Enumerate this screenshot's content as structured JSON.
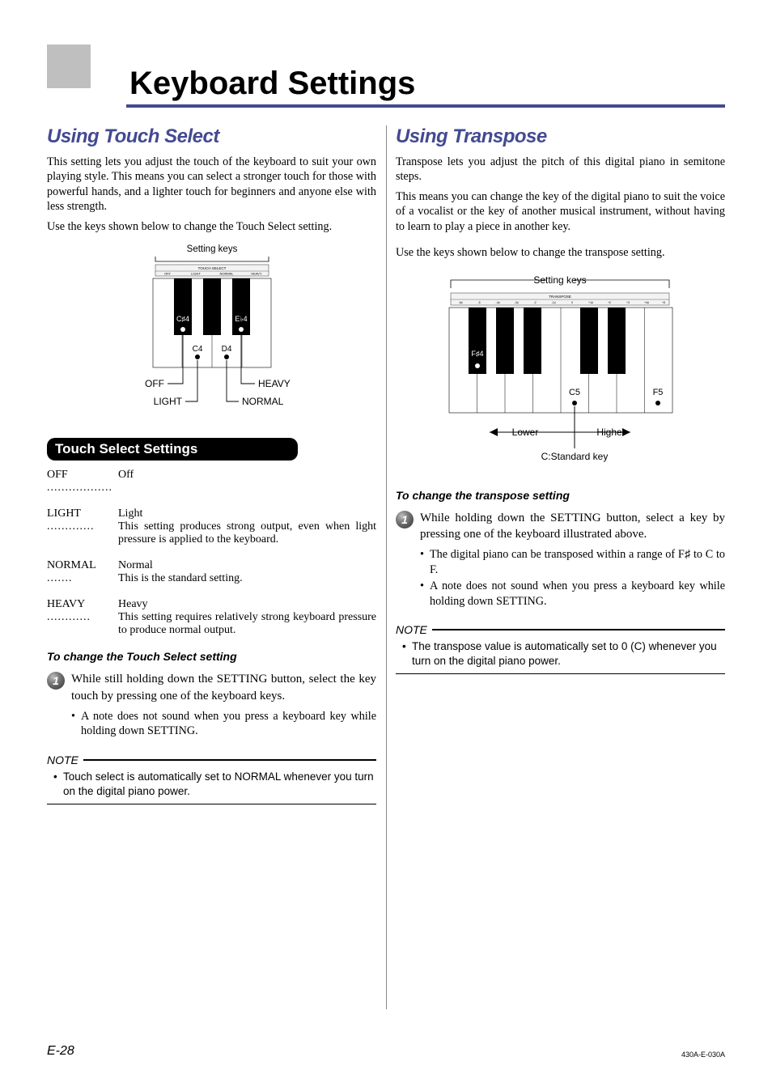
{
  "chapter_title": "Keyboard Settings",
  "left": {
    "section_title": "Using Touch Select",
    "intro1": "This setting lets you adjust the touch of the keyboard to suit your own playing style. This means you can select a stronger touch for those with powerful hands, and a lighter touch for beginners and anyone else with less strength.",
    "intro2": "Use the keys shown below to change the Touch Select setting.",
    "diagram": {
      "caption": "Setting keys",
      "sticker": {
        "top": "TOUCH SELECT",
        "items": [
          "OFF",
          "LIGHT",
          "NORMAL",
          "HEAVY"
        ]
      },
      "black_keys": [
        "C♯4",
        "E♭4"
      ],
      "white_keys": [
        "C4",
        "D4"
      ],
      "leaders": {
        "off": "OFF",
        "light": "LIGHT",
        "normal": "NORMAL",
        "heavy": "HEAVY"
      }
    },
    "band_title": "Touch Select Settings",
    "settings": [
      {
        "term": "OFF",
        "label": "Off",
        "desc": ""
      },
      {
        "term": "LIGHT",
        "label": "Light",
        "desc": "This setting produces strong output, even when light pressure is applied to the keyboard."
      },
      {
        "term": "NORMAL",
        "label": "Normal",
        "desc": "This is the standard setting."
      },
      {
        "term": "HEAVY",
        "label": "Heavy",
        "desc": "This setting requires relatively strong keyboard pressure to produce normal output."
      }
    ],
    "howto_title": "To change the Touch Select setting",
    "step1": "While still holding down the SETTING button, select the key touch by pressing one of the keyboard keys.",
    "step1_bullets": [
      "A note does not sound when you press a keyboard key while holding down SETTING."
    ],
    "note_label": "NOTE",
    "note_items": [
      "Touch select is automatically set to NORMAL whenever you turn on the digital piano power."
    ]
  },
  "right": {
    "section_title": "Using Transpose",
    "intro1": "Transpose lets you adjust the pitch of this digital piano in semitone steps.",
    "intro2": "This means you can change the key of the digital piano to suit the voice of a vocalist or the key of another musical instrument, without having to learn to play a piece in another key.",
    "intro3": "Use the keys shown below to change the transpose setting.",
    "diagram": {
      "caption": "Setting keys",
      "sticker": {
        "top": "TRANSPOSE",
        "items": [
          "-6♯",
          "-5",
          "-4♯",
          "-3♯",
          "-2",
          "-1♯",
          "0",
          "+1♯",
          "+2",
          "+3",
          "+4♯",
          "+5"
        ]
      },
      "black_key": "F♯4",
      "white_keys": [
        "C5",
        "F5"
      ],
      "lower": "Lower",
      "higher": "Higher",
      "std": "C:Standard key"
    },
    "howto_title": "To change the transpose setting",
    "step1": "While holding down the SETTING button, select a key by pressing one of the keyboard illustrated above.",
    "step1_bullets": [
      "The digital piano can be transposed within a range of F♯ to C to F.",
      "A note does not sound when you press a keyboard key while holding down SETTING."
    ],
    "note_label": "NOTE",
    "note_items": [
      "The transpose value is automatically set to 0 (C) whenever you turn on the digital piano power."
    ]
  },
  "footer": {
    "page": "E-28",
    "doc": "430A-E-030A"
  }
}
